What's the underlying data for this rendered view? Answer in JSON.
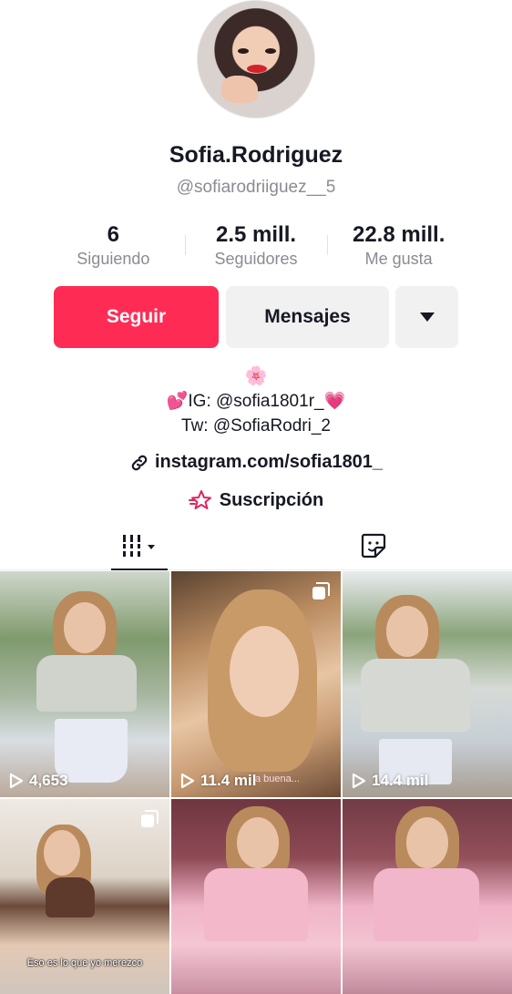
{
  "profile": {
    "display_name": "Sofia.Rodriguez",
    "username": "@sofiarodriiguez__5"
  },
  "stats": [
    {
      "value": "6",
      "label": "Siguiendo"
    },
    {
      "value": "2.5 mill.",
      "label": "Seguidores"
    },
    {
      "value": "22.8 mill.",
      "label": "Me gusta"
    }
  ],
  "actions": {
    "follow_label": "Seguir",
    "message_label": "Mensajes",
    "more_icon": "caret-down-icon"
  },
  "bio": {
    "flower": "🌸",
    "ig_prefix": "💕",
    "ig_text": "IG: @sofia1801r_",
    "ig_suffix": "💗",
    "tw_text": "Tw: @SofiaRodri_2"
  },
  "link": {
    "icon": "link-icon",
    "text": "instagram.com/sofia1801_"
  },
  "subscription": {
    "icon": "star-icon",
    "text": "Suscripción"
  },
  "tabs": {
    "videos_icon": "grid-icon",
    "liked_icon": "sticker-icon"
  },
  "videos": [
    {
      "views": "4,653",
      "multi": false,
      "caption": ""
    },
    {
      "views": "11.4 mil",
      "multi": true,
      "caption": "",
      "overlay": "a buena..."
    },
    {
      "views": "14.4 mil",
      "multi": false,
      "caption": ""
    },
    {
      "views": "",
      "multi": true,
      "caption": "Eso es lo que yo merezco"
    },
    {
      "views": "",
      "multi": false,
      "caption": ""
    },
    {
      "views": "",
      "multi": false,
      "caption": ""
    }
  ],
  "colors": {
    "accent": "#fe2c55",
    "secondary_button": "#f1f1f2",
    "muted_text": "#8a8b91"
  }
}
